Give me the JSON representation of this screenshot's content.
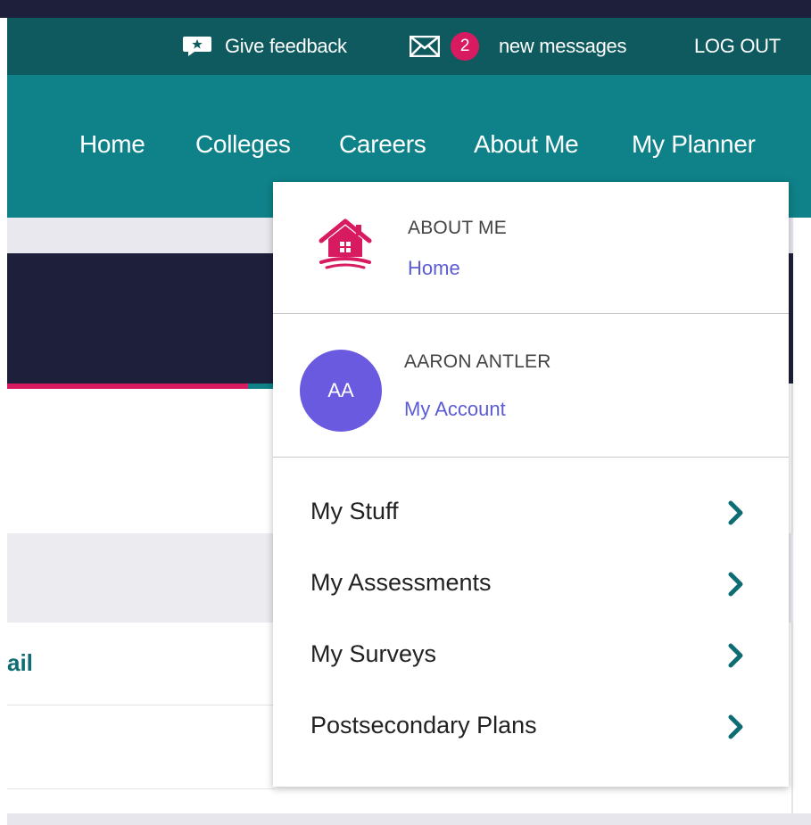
{
  "utility_bar": {
    "feedback_label": "Give feedback",
    "message_count": "2",
    "messages_label": "new messages",
    "logout_label": "LOG OUT"
  },
  "nav": {
    "items": [
      {
        "label": "Home"
      },
      {
        "label": "Colleges"
      },
      {
        "label": "Careers"
      },
      {
        "label": "About Me"
      },
      {
        "label": "My Planner"
      }
    ]
  },
  "background": {
    "partial_text": "ail"
  },
  "dropdown": {
    "about": {
      "heading": "ABOUT ME",
      "link": "Home"
    },
    "account": {
      "initials": "AA",
      "name": "AARON ANTLER",
      "link": "My Account"
    },
    "menu": [
      {
        "label": "My Stuff"
      },
      {
        "label": "My Assessments"
      },
      {
        "label": "My Surveys"
      },
      {
        "label": "Postsecondary Plans"
      }
    ]
  },
  "colors": {
    "teal": "#0e8288",
    "dark_teal": "#0f5a5e",
    "navy": "#1e1f3a",
    "magenta": "#d81b60",
    "link_purple": "#5b5bd6",
    "avatar_purple": "#6a5ae0"
  }
}
